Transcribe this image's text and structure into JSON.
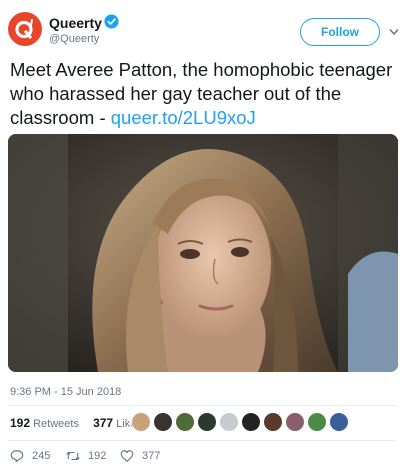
{
  "account": {
    "name": "Queerty",
    "handle": "@Queerty",
    "verified": true,
    "avatar_letter": "Q'",
    "avatar_color": "#e8462a"
  },
  "follow_button": {
    "label": "Follow"
  },
  "tweet": {
    "text": "Meet Averee Patton, the homophobic teenager who harassed her gay teacher out of the classroom - ",
    "link": "queer.to/2LU9xoJ",
    "timestamp": "9:36 PM - 15 Jun 2018"
  },
  "stats": {
    "retweets_count": "192",
    "retweets_label": "Retweets",
    "likes_count": "377",
    "likes_label": "Likes"
  },
  "actions": {
    "replies": "245",
    "retweets": "192",
    "likes": "377"
  },
  "colors": {
    "link": "#1da1f2",
    "muted": "#657786",
    "text": "#14171a"
  }
}
